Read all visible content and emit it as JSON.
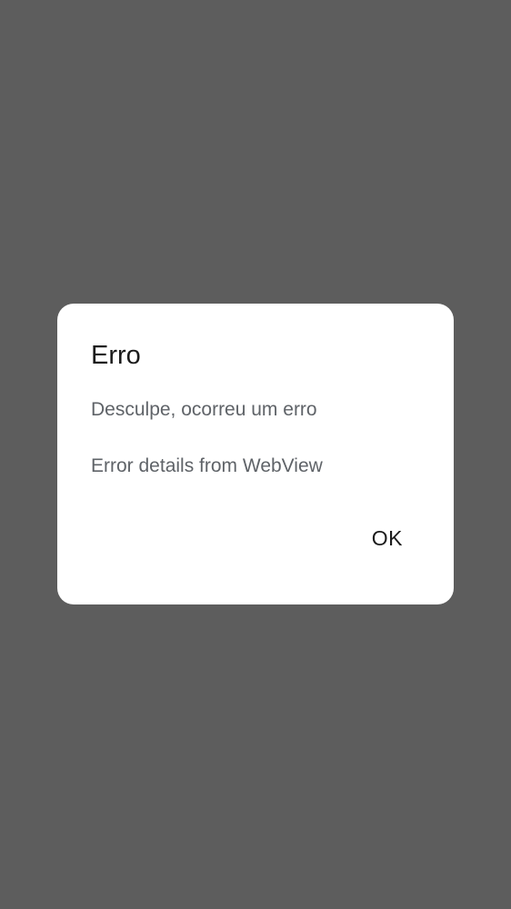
{
  "dialog": {
    "title": "Erro",
    "message": "Desculpe, ocorreu um erro",
    "details": "Error details from WebView",
    "ok_label": "OK"
  },
  "colors": {
    "scrim": "#5d5d5d",
    "dialog_background": "#ffffff",
    "title_text": "#1b1b1b",
    "body_text": "#5f6368"
  }
}
